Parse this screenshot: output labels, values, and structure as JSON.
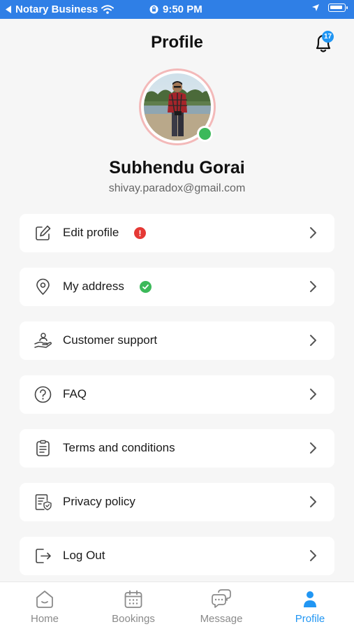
{
  "status_bar": {
    "carrier": "Notary Business",
    "time": "9:50 PM"
  },
  "header": {
    "title": "Profile",
    "notification_count": "17"
  },
  "profile": {
    "name": "Subhendu Gorai",
    "email": "shivay.paradox@gmail.com",
    "online": true
  },
  "menu": [
    {
      "label": "Edit profile",
      "icon": "edit-icon",
      "badge": "alert"
    },
    {
      "label": "My address",
      "icon": "location-pin-icon",
      "badge": "verified"
    },
    {
      "label": "Customer support",
      "icon": "hand-support-icon"
    },
    {
      "label": "FAQ",
      "icon": "question-circle-icon"
    },
    {
      "label": "Terms and conditions",
      "icon": "clipboard-list-icon"
    },
    {
      "label": "Privacy policy",
      "icon": "document-shield-icon"
    },
    {
      "label": "Log Out",
      "icon": "logout-icon"
    }
  ],
  "bottom_nav": {
    "items": [
      {
        "label": "Home",
        "icon": "home-icon"
      },
      {
        "label": "Bookings",
        "icon": "calendar-icon"
      },
      {
        "label": "Message",
        "icon": "chat-bubbles-icon"
      },
      {
        "label": "Profile",
        "icon": "user-icon"
      }
    ],
    "active": "Profile"
  },
  "colors": {
    "status_bar": "#2f7fe6",
    "accent": "#2196f3",
    "online": "#3cb95a",
    "alert": "#e53935",
    "avatar_ring": "#f3b9b9"
  }
}
